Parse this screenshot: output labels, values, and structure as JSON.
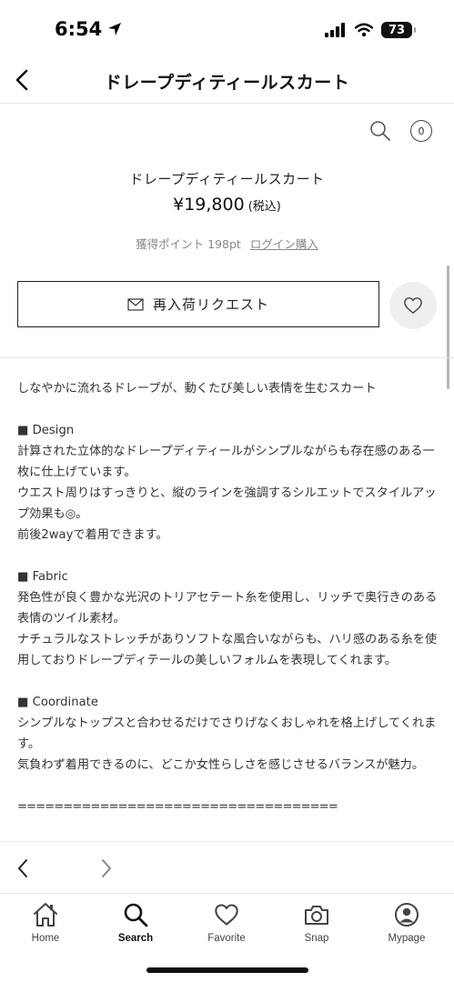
{
  "status_bar": {
    "time": "6:54",
    "battery": "73"
  },
  "header": {
    "title": "ドレープディティールスカート"
  },
  "cart": {
    "count": "0"
  },
  "product": {
    "name": "ドレープディティールスカート",
    "price": "¥19,800",
    "tax_label": "(税込)",
    "points": "獲得ポイント 198pt",
    "login_link": "ログイン購入"
  },
  "restock_button": {
    "label": "再入荷リクエスト"
  },
  "description": {
    "lines": [
      "しなやかに流れるドレープが、動くたび美しい表情を生むスカート",
      "",
      "■ Design",
      "計算された立体的なドレープディティールがシンプルながらも存在感のある一枚に仕上げています。",
      "ウエスト周りはすっきりと、縦のラインを強調するシルエットでスタイルアップ効果も◎。",
      "前後2wayで着用できます。",
      "",
      "■ Fabric",
      "発色性が良く豊かな光沢のトリアセテート糸を使用し、リッチで奥行きのある表情のツイル素材。",
      "ナチュラルなストレッチがありソフトな風合いながらも、ハリ感のある糸を使用しておりドレープディテールの美しいフォルムを表現してくれます。",
      "",
      "■ Coordinate",
      "シンプルなトップスと合わせるだけでさりげなくおしゃれを格上げしてくれます。",
      "気負わず着用できるのに、どこか女性らしさを感じさせるバランスが魅力。",
      "",
      "==================================="
    ]
  },
  "tabs": [
    {
      "label": "Home",
      "icon": "home-icon"
    },
    {
      "label": "Search",
      "icon": "search-icon",
      "active": true
    },
    {
      "label": "Favorite",
      "icon": "heart-icon"
    },
    {
      "label": "Snap",
      "icon": "camera-icon"
    },
    {
      "label": "Mypage",
      "icon": "user-icon"
    }
  ]
}
